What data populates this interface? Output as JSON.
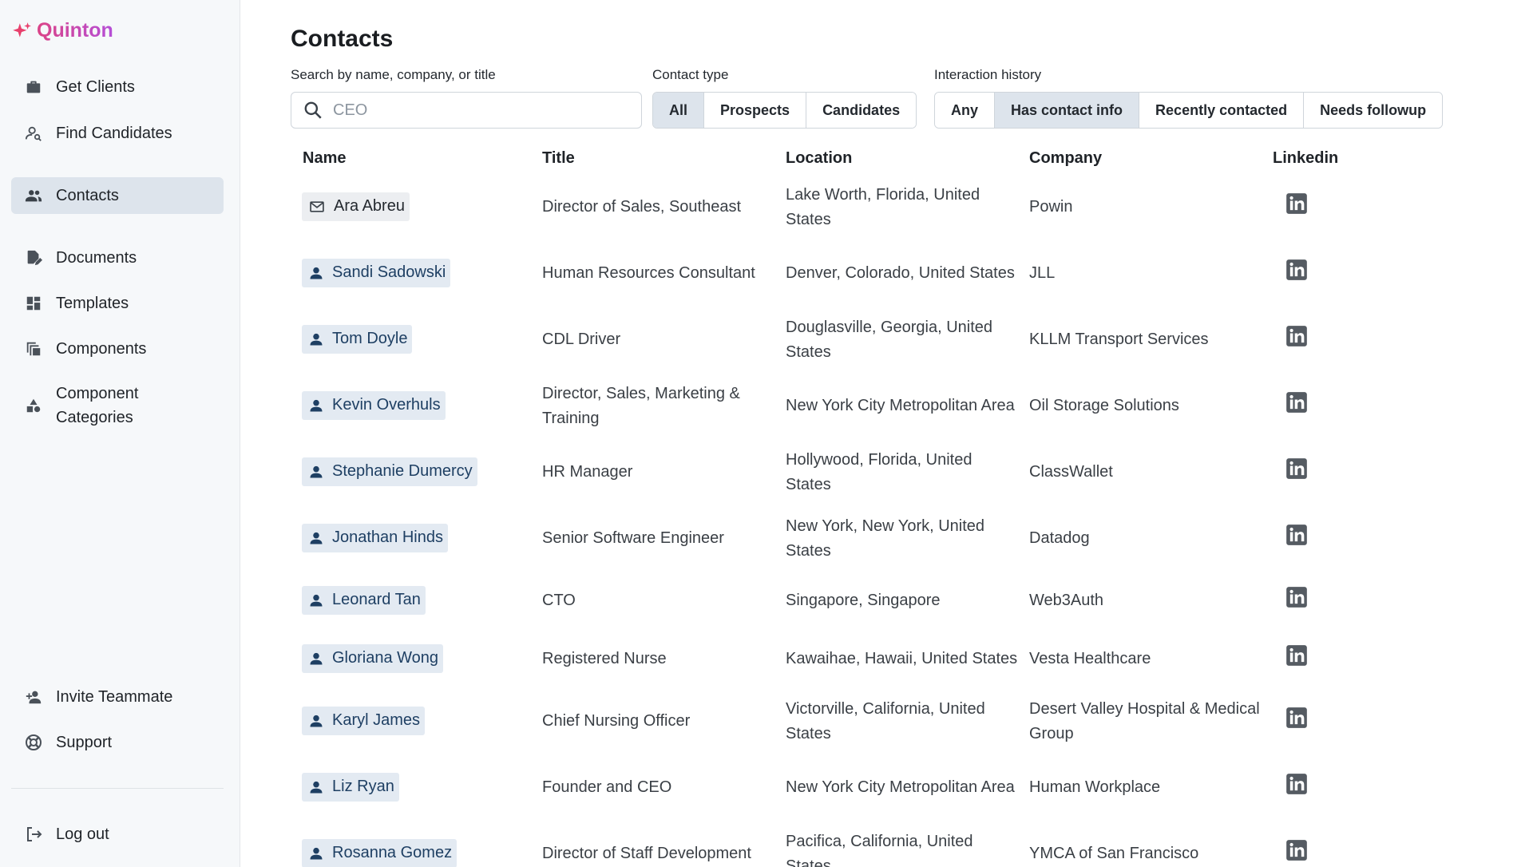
{
  "app": {
    "brand": "Quinton"
  },
  "sidebar": {
    "items": [
      {
        "label": "Get Clients",
        "icon": "briefcase-icon"
      },
      {
        "label": "Find Candidates",
        "icon": "person-search-icon"
      },
      {
        "label": "Contacts",
        "icon": "people-icon",
        "active": true
      },
      {
        "label": "Documents",
        "icon": "document-edit-icon"
      },
      {
        "label": "Templates",
        "icon": "dashboard-icon"
      },
      {
        "label": "Components",
        "icon": "copy-icon"
      },
      {
        "label": "Component Categories",
        "icon": "category-icon"
      }
    ],
    "bottom": [
      {
        "label": "Invite Teammate",
        "icon": "person-add-icon"
      },
      {
        "label": "Support",
        "icon": "lifebuoy-icon"
      }
    ],
    "logout": "Log out"
  },
  "page": {
    "title": "Contacts"
  },
  "filters": {
    "search_label": "Search by name, company, or title",
    "search_placeholder": "CEO",
    "contact_type_label": "Contact type",
    "contact_type_options": [
      "All",
      "Prospects",
      "Candidates"
    ],
    "contact_type_selected": "All",
    "history_label": "Interaction history",
    "history_options": [
      "Any",
      "Has contact info",
      "Recently contacted",
      "Needs followup"
    ],
    "history_selected": "Has contact info"
  },
  "table": {
    "headers": {
      "name": "Name",
      "title": "Title",
      "location": "Location",
      "company": "Company",
      "linkedin": "Linkedin"
    },
    "rows": [
      {
        "name": "Ara Abreu",
        "kind": "email",
        "title": "Director of Sales, Southeast",
        "location": "Lake Worth, Florida, United States",
        "company": "Powin"
      },
      {
        "name": "Sandi Sadowski",
        "kind": "person",
        "title": "Human Resources Consultant",
        "location": "Denver, Colorado, United States",
        "company": "JLL"
      },
      {
        "name": "Tom Doyle",
        "kind": "person",
        "title": "CDL Driver",
        "location": "Douglasville, Georgia, United States",
        "company": "KLLM Transport Services"
      },
      {
        "name": "Kevin Overhuls",
        "kind": "person",
        "title": "Director, Sales, Marketing & Training",
        "location": "New York City Metropolitan Area",
        "company": "Oil Storage Solutions"
      },
      {
        "name": "Stephanie Dumercy",
        "kind": "person",
        "title": "HR Manager",
        "location": "Hollywood, Florida, United States",
        "company": "ClassWallet"
      },
      {
        "name": "Jonathan Hinds",
        "kind": "person",
        "title": "Senior Software Engineer",
        "location": "New York, New York, United States",
        "company": "Datadog"
      },
      {
        "name": "Leonard Tan",
        "kind": "person",
        "title": "CTO",
        "location": "Singapore, Singapore",
        "company": "Web3Auth"
      },
      {
        "name": "Gloriana Wong",
        "kind": "person",
        "title": "Registered Nurse",
        "location": "Kawaihae, Hawaii, United States",
        "company": "Vesta Healthcare"
      },
      {
        "name": "Karyl James",
        "kind": "person",
        "title": "Chief Nursing Officer",
        "location": "Victorville, California, United States",
        "company": "Desert Valley Hospital & Medical Group"
      },
      {
        "name": "Liz Ryan",
        "kind": "person",
        "title": "Founder and CEO",
        "location": "New York City Metropolitan Area",
        "company": "Human Workplace"
      },
      {
        "name": "Rosanna Gomez",
        "kind": "person",
        "title": "Director of Staff Development",
        "location": "Pacifica, California, United States",
        "company": "YMCA of San Francisco"
      }
    ]
  },
  "colors": {
    "accent": "#1e3f63",
    "chip": "#e3eaf2",
    "active_nav": "#dde4ec",
    "brand_start": "#e8406c",
    "brand_end": "#b54ed7"
  }
}
